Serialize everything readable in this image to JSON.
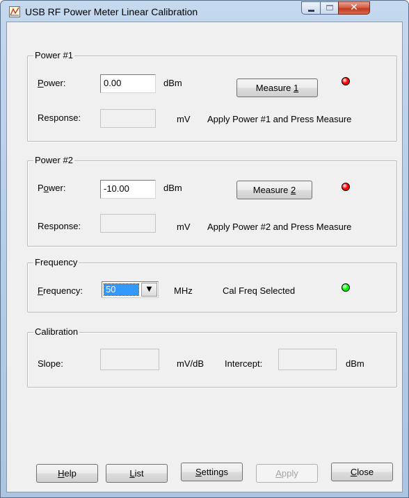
{
  "window": {
    "title": "USB RF Power Meter Linear Calibration",
    "close_glyph": "✕"
  },
  "power1": {
    "legend": "Power #1",
    "power_label": {
      "pre": "",
      "mnemonic": "P",
      "post": "ower:"
    },
    "power_value": "0.00",
    "power_unit": "dBm",
    "measure_label": {
      "pre": "Measure ",
      "mnemonic": "1",
      "post": ""
    },
    "indicator_color": "#ff0000",
    "response_label": "Response:",
    "response_value": "",
    "response_unit": "mV",
    "status": "Apply Power #1 and Press Measure"
  },
  "power2": {
    "legend": "Power #2",
    "power_label": {
      "pre": "P",
      "mnemonic": "o",
      "post": "wer:"
    },
    "power_value": "-10.00",
    "power_unit": "dBm",
    "measure_label": {
      "pre": "Measure ",
      "mnemonic": "2",
      "post": ""
    },
    "indicator_color": "#ff0000",
    "response_label": "Response:",
    "response_value": "",
    "response_unit": "mV",
    "status": "Apply Power #2 and Press Measure"
  },
  "frequency": {
    "legend": "Frequency",
    "label": {
      "pre": "",
      "mnemonic": "F",
      "post": "requency:"
    },
    "selected": "50",
    "unit": "MHz",
    "status": "Cal Freq Selected",
    "indicator_color": "#00ff00",
    "dropdown_icon": "▼"
  },
  "calibration": {
    "legend": "Calibration",
    "slope_label": "Slope:",
    "slope_value": "",
    "slope_unit": "mV/dB",
    "intercept_label": "Intercept:",
    "intercept_value": "",
    "intercept_unit": "dBm"
  },
  "buttons": {
    "help": {
      "pre": "",
      "mnemonic": "H",
      "post": "elp"
    },
    "list": {
      "pre": "",
      "mnemonic": "L",
      "post": "ist"
    },
    "settings": {
      "pre": "",
      "mnemonic": "S",
      "post": "ettings"
    },
    "apply": {
      "pre": "",
      "mnemonic": "A",
      "post": "pply"
    },
    "close": {
      "pre": "",
      "mnemonic": "C",
      "post": "lose"
    }
  }
}
